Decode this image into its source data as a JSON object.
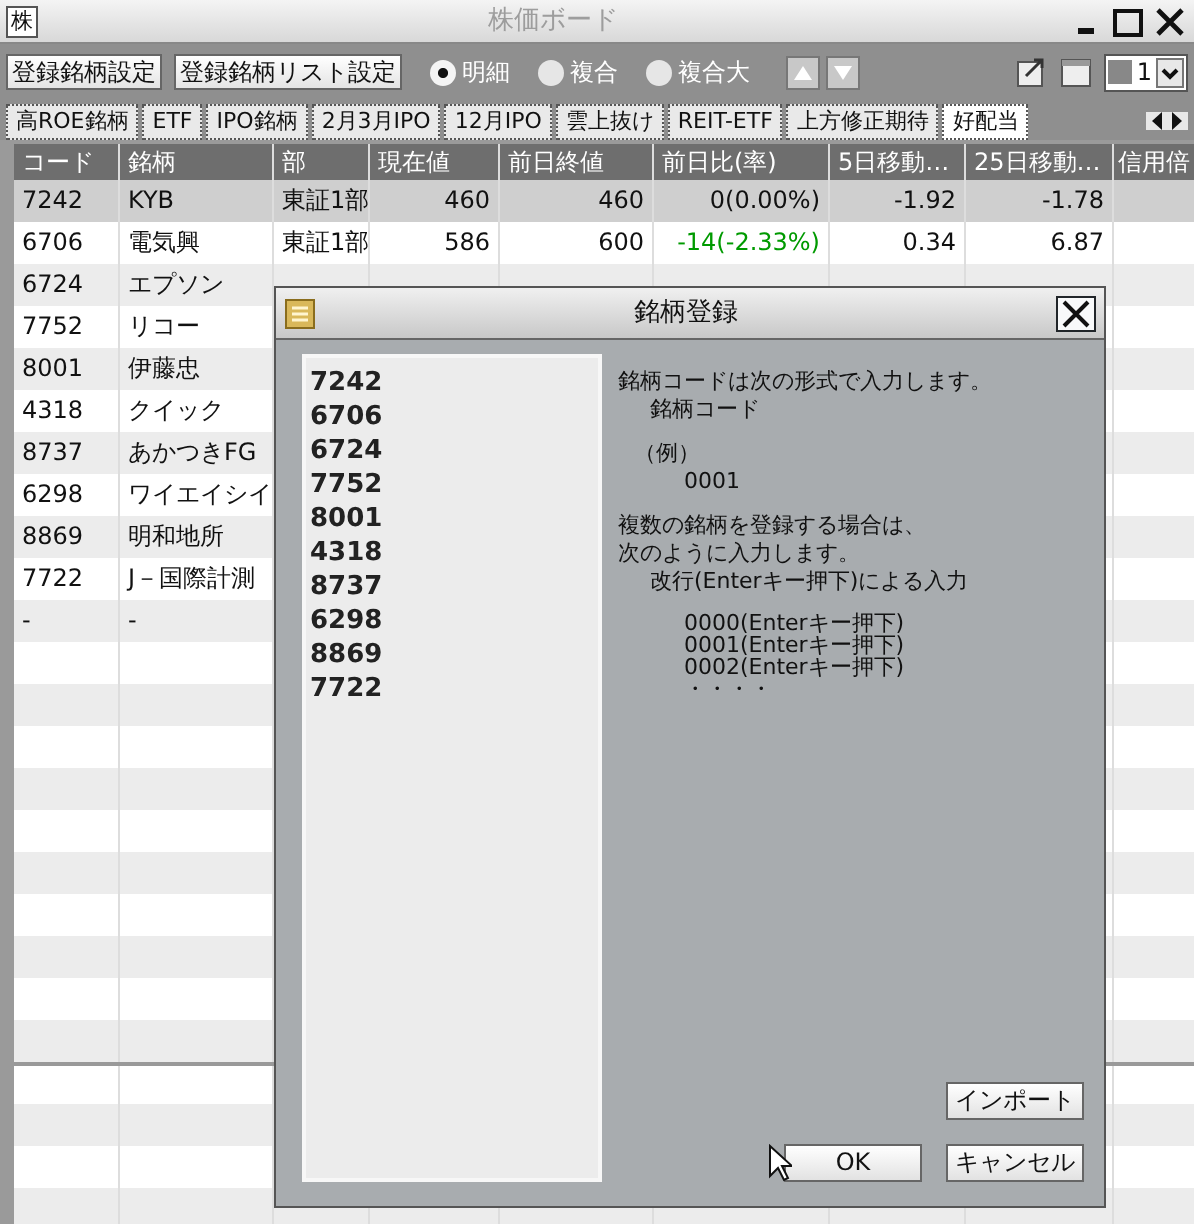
{
  "window": {
    "icon_char": "株",
    "title": "株価ボード"
  },
  "toolbar": {
    "buttons": [
      "登録銘柄設定",
      "登録銘柄リスト設定"
    ],
    "view_modes": [
      {
        "label": "明細",
        "selected": true
      },
      {
        "label": "複合",
        "selected": false
      },
      {
        "label": "複合大",
        "selected": false
      }
    ],
    "page_select": {
      "value": "1"
    }
  },
  "tabs": [
    {
      "label": "高ROE銘柄",
      "selected": false
    },
    {
      "label": "ETF",
      "selected": false
    },
    {
      "label": "IPO銘柄",
      "selected": false
    },
    {
      "label": "2月3月IPO",
      "selected": false
    },
    {
      "label": "12月IPO",
      "selected": false
    },
    {
      "label": "雲上抜け",
      "selected": false
    },
    {
      "label": "REIT-ETF",
      "selected": false
    },
    {
      "label": "上方修正期待",
      "selected": false
    },
    {
      "label": "好配当",
      "selected": true
    }
  ],
  "table": {
    "columns": [
      "コード",
      "銘柄",
      "部",
      "現在値",
      "前日終値",
      "前日比(率)",
      "5日移動…",
      "25日移動…",
      "信用倍"
    ],
    "rows": [
      {
        "cells": [
          "7242",
          "KYB",
          "東証1部",
          "460",
          "460",
          "0(0.00%)",
          "-1.92",
          "-1.78"
        ],
        "selected": true,
        "color": "#111111"
      },
      {
        "cells": [
          "6706",
          "電気興",
          "東証1部",
          "586",
          "600",
          "-14(-2.33%)",
          "0.34",
          "6.87"
        ],
        "selected": false,
        "color": "#009a00"
      },
      {
        "cells": [
          "6724",
          "エプソン"
        ],
        "selected": false
      },
      {
        "cells": [
          "7752",
          "リコー"
        ],
        "selected": false
      },
      {
        "cells": [
          "8001",
          "伊藤忠"
        ],
        "selected": false
      },
      {
        "cells": [
          "4318",
          "クイック"
        ],
        "selected": false
      },
      {
        "cells": [
          "8737",
          "あかつきFG"
        ],
        "selected": false
      },
      {
        "cells": [
          "6298",
          "ワイエイシイ"
        ],
        "selected": false
      },
      {
        "cells": [
          "8869",
          "明和地所"
        ],
        "selected": false
      },
      {
        "cells": [
          "7722",
          "J－国際計測"
        ],
        "selected": false
      },
      {
        "cells": [
          "-",
          "-"
        ],
        "selected": false
      }
    ]
  },
  "dialog": {
    "title": "銘柄登録",
    "codes": [
      "7242",
      "6706",
      "6724",
      "7752",
      "8001",
      "4318",
      "8737",
      "6298",
      "8869",
      "7722"
    ],
    "instructions": [
      [
        {
          "text": "銘柄コードは次の形式で入力します。",
          "kind": "body"
        },
        {
          "text": "銘柄コード",
          "kind": "label"
        }
      ],
      [
        {
          "text": "（例）",
          "kind": "note"
        },
        {
          "text": "0001",
          "kind": "example"
        }
      ],
      [
        {
          "text": "複数の銘柄を登録する場合は、",
          "kind": "body"
        },
        {
          "text": "次のように入力します。",
          "kind": "body"
        },
        {
          "text": "改行(Enterキー押下)による入力",
          "kind": "label"
        }
      ],
      [
        {
          "text": "0000(Enterキー押下)",
          "kind": "example"
        },
        {
          "text": "0001(Enterキー押下)",
          "kind": "example"
        },
        {
          "text": "0002(Enterキー押下)",
          "kind": "example"
        },
        {
          "text": "・・・・",
          "kind": "example"
        }
      ]
    ],
    "import_button": "インポート",
    "ok_button": "OK",
    "cancel_button": "キャンセル"
  }
}
